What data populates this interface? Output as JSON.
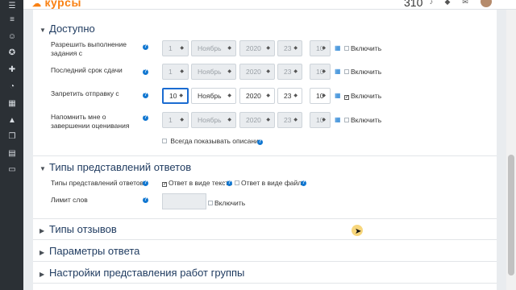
{
  "header": {
    "logo_mark": "☁",
    "logo_text": "курсы",
    "counter": "310"
  },
  "sidebar": {
    "icons": [
      "menu-icon",
      "people-icon",
      "badge-icon",
      "competency-icon",
      "dashboard-icon",
      "calendar-icon",
      "graduation-icon",
      "files-icon",
      "clipboard-icon",
      "folder-icon"
    ]
  },
  "sections": {
    "available": {
      "title": "Доступно",
      "rows": [
        {
          "label": "Разрешить выполнение задания с",
          "day": "1",
          "month": "Ноябрь",
          "year": "2020",
          "hour": "23",
          "minute": "10",
          "enable": "Включить",
          "enabled": false
        },
        {
          "label": "Последний срок сдачи",
          "day": "1",
          "month": "Ноябрь",
          "year": "2020",
          "hour": "23",
          "minute": "10",
          "enable": "Включить",
          "enabled": false
        },
        {
          "label": "Запретить отправку с",
          "day": "10",
          "month": "Ноябрь",
          "year": "2020",
          "hour": "23",
          "minute": "10",
          "enable": "Включить",
          "enabled": true
        },
        {
          "label": "Напомнить мне о завершении оценивания",
          "day": "1",
          "month": "Ноябрь",
          "year": "2020",
          "hour": "23",
          "minute": "10",
          "enable": "Включить",
          "enabled": false
        }
      ],
      "always_show": "Всегда показывать описание"
    },
    "submission_types": {
      "title": "Типы представлений ответов",
      "types_label": "Типы представлений ответов",
      "online_text": "Ответ в виде текста",
      "file_submission": "Ответ в виде файла",
      "word_limit_label": "Лимит слов",
      "word_limit_enable": "Включить"
    },
    "feedback": {
      "title": "Типы отзывов"
    },
    "response": {
      "title": "Параметры ответа"
    },
    "group": {
      "title": "Настройки представления работ группы"
    }
  }
}
